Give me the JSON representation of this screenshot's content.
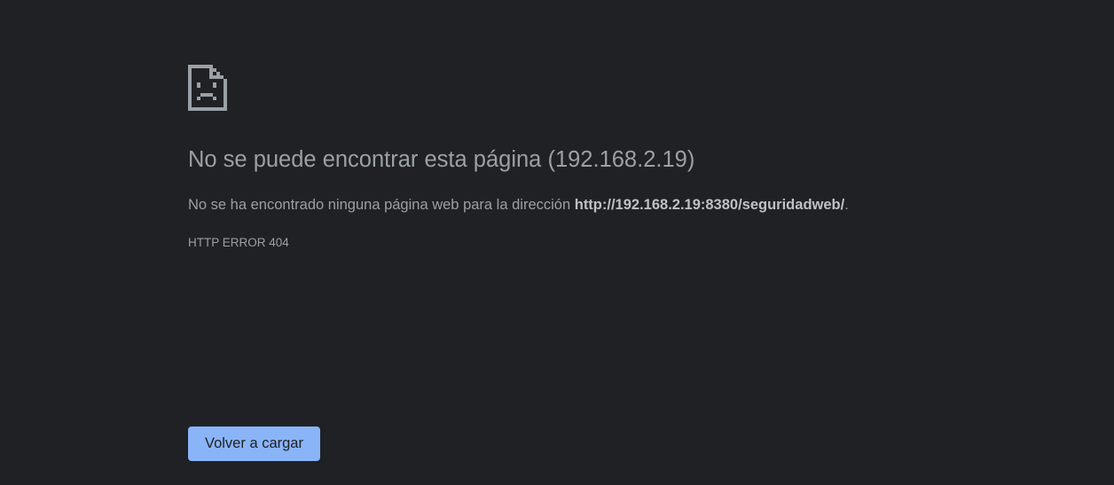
{
  "error": {
    "icon": "sad-page-icon",
    "heading": "No se puede encontrar esta página (192.168.2.19)",
    "message_prefix": "No se ha encontrado ninguna página web para la dirección ",
    "url": "http://192.168.2.19:8380/seguridadweb/",
    "message_suffix": ".",
    "code": "HTTP ERROR 404"
  },
  "actions": {
    "reload_label": "Volver a cargar"
  },
  "colors": {
    "background": "#202124",
    "text": "#9aa0a6",
    "button": "#8ab4f8",
    "icon": "#9aa0a6"
  }
}
